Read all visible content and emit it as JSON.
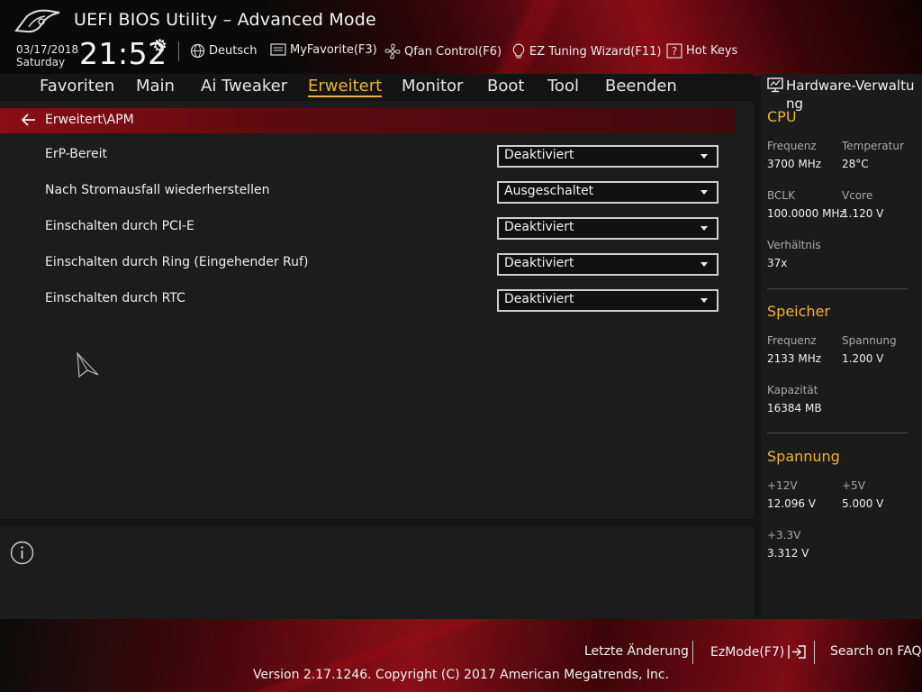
{
  "header": {
    "title": "UEFI BIOS Utility – Advanced Mode",
    "date": "03/17/2018",
    "weekday": "Saturday",
    "time": "21:52",
    "items": {
      "language": "Deutsch",
      "myfavorite": "MyFavorite(F3)",
      "qfan": "Qfan Control(F6)",
      "ez_tuning": "EZ Tuning Wizard(F11)",
      "hotkeys": "Hot Keys"
    }
  },
  "nav": {
    "tabs": [
      {
        "label": "Favoriten"
      },
      {
        "label": "Main"
      },
      {
        "label": "Ai Tweaker"
      },
      {
        "label": "Erweitert",
        "active": true
      },
      {
        "label": "Monitor"
      },
      {
        "label": "Boot"
      },
      {
        "label": "Tool"
      },
      {
        "label": "Beenden"
      }
    ]
  },
  "breadcrumb": "Erweitert\\APM",
  "settings": [
    {
      "label": "ErP-Bereit",
      "value": "Deaktiviert"
    },
    {
      "label": "Nach Stromausfall wiederherstellen",
      "value": "Ausgeschaltet"
    },
    {
      "label": "Einschalten durch PCI-E",
      "value": "Deaktiviert"
    },
    {
      "label": "Einschalten durch Ring (Eingehender Ruf)",
      "value": "Deaktiviert"
    },
    {
      "label": "Einschalten durch RTC",
      "value": "Deaktiviert"
    }
  ],
  "hw": {
    "title": "Hardware-Verwaltung",
    "cpu": {
      "heading": "CPU",
      "freq_label": "Frequenz",
      "freq": "3700 MHz",
      "temp_label": "Temperatur",
      "temp": "28°C",
      "bclk_label": "BCLK",
      "bclk": "100.0000 MHz",
      "vcore_label": "Vcore",
      "vcore": "1.120 V",
      "ratio_label": "Verhältnis",
      "ratio": "37x"
    },
    "memory": {
      "heading": "Speicher",
      "freq_label": "Frequenz",
      "freq": "2133 MHz",
      "volt_label": "Spannung",
      "volt": "1.200 V",
      "cap_label": "Kapazität",
      "cap": "16384 MB"
    },
    "voltage": {
      "heading": "Spannung",
      "v12_label": "+12V",
      "v12": "12.096 V",
      "v5_label": "+5V",
      "v5": "5.000 V",
      "v33_label": "+3.3V",
      "v33": "3.312 V"
    }
  },
  "footer": {
    "last_change": "Letzte Änderung",
    "ezmode": "EzMode(F7)",
    "faq": "Search on FAQ",
    "copyright": "Version 2.17.1246. Copyright (C) 2017 American Megatrends, Inc."
  },
  "colors": {
    "accent": "#f0b429",
    "breadcrumb_bar": "#8a0e16"
  }
}
